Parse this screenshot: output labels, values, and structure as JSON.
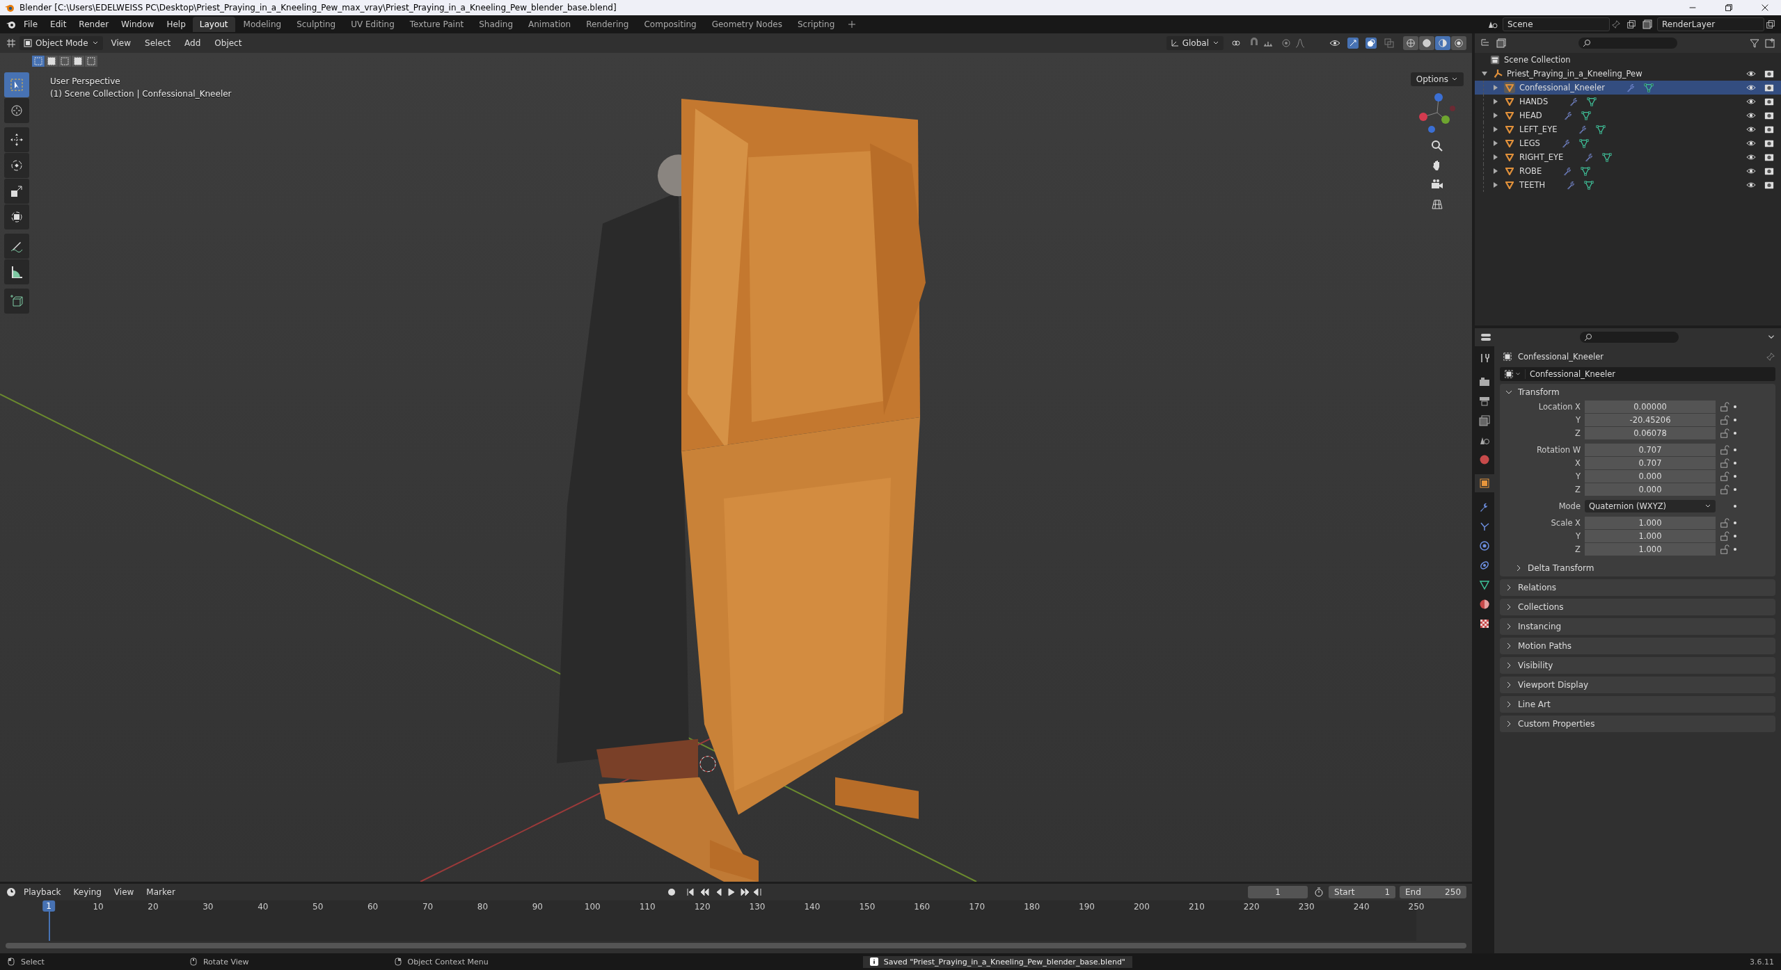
{
  "window": {
    "title": "Blender [C:\\Users\\EDELWEISS PC\\Desktop\\Priest_Praying_in_a_Kneeling_Pew_max_vray\\Priest_Praying_in_a_Kneeling_Pew_blender_base.blend]"
  },
  "menu": [
    "File",
    "Edit",
    "Render",
    "Window",
    "Help"
  ],
  "workspaces": [
    {
      "label": "Layout",
      "selected": true
    },
    {
      "label": "Modeling",
      "selected": false
    },
    {
      "label": "Sculpting",
      "selected": false
    },
    {
      "label": "UV Editing",
      "selected": false
    },
    {
      "label": "Texture Paint",
      "selected": false
    },
    {
      "label": "Shading",
      "selected": false
    },
    {
      "label": "Animation",
      "selected": false
    },
    {
      "label": "Rendering",
      "selected": false
    },
    {
      "label": "Compositing",
      "selected": false
    },
    {
      "label": "Geometry Nodes",
      "selected": false
    },
    {
      "label": "Scripting",
      "selected": false
    }
  ],
  "scene": "Scene",
  "view_layer": "RenderLayer",
  "viewport": {
    "mode": "Object Mode",
    "menus": [
      "View",
      "Select",
      "Add",
      "Object"
    ],
    "orientation": "Global",
    "options": "Options",
    "select_modes": [
      {
        "selected": true
      },
      {
        "selected": false
      },
      {
        "selected": false
      },
      {
        "selected": false
      },
      {
        "selected": false
      }
    ],
    "shading": [
      {
        "selected": false
      },
      {
        "selected": false
      },
      {
        "selected": true
      },
      {
        "selected": false
      }
    ],
    "overlay_lines": [
      "User Perspective",
      "(1) Scene Collection | Confessional_Kneeler"
    ],
    "tool_groups": [
      [
        {
          "kind": "select",
          "selected": true
        },
        {
          "kind": "cursor",
          "selected": false
        }
      ],
      [
        {
          "kind": "move",
          "selected": false
        },
        {
          "kind": "rotate",
          "selected": false
        },
        {
          "kind": "scale",
          "selected": false
        },
        {
          "kind": "transform",
          "selected": false
        }
      ],
      [
        {
          "kind": "annotate",
          "selected": false
        },
        {
          "kind": "measure",
          "selected": false
        }
      ],
      [
        {
          "kind": "add-cube",
          "selected": false
        }
      ]
    ]
  },
  "outliner": {
    "scene_collection": "Scene Collection",
    "items": [
      {
        "name": "Priest_Praying_in_a_Kneeling_Pew",
        "kind": "empty",
        "expanded": true,
        "selected": false,
        "children": [
          {
            "name": "Confessional_Kneeler",
            "kind": "mesh",
            "expanded": false,
            "selected": true
          },
          {
            "name": "HANDS",
            "kind": "mesh",
            "expanded": false,
            "selected": false
          },
          {
            "name": "HEAD",
            "kind": "mesh",
            "expanded": false,
            "selected": false
          },
          {
            "name": "LEFT_EYE",
            "kind": "mesh",
            "expanded": false,
            "selected": false
          },
          {
            "name": "LEGS",
            "kind": "mesh",
            "expanded": false,
            "selected": false
          },
          {
            "name": "RIGHT_EYE",
            "kind": "mesh",
            "expanded": false,
            "selected": false
          },
          {
            "name": "ROBE",
            "kind": "mesh",
            "expanded": false,
            "selected": false
          },
          {
            "name": "TEETH",
            "kind": "mesh",
            "expanded": false,
            "selected": false
          }
        ]
      }
    ]
  },
  "properties": {
    "tabs": [
      {
        "kind": "tool",
        "selected": false
      },
      {
        "kind": "render",
        "selected": false
      },
      {
        "kind": "output",
        "selected": false
      },
      {
        "kind": "view-layer",
        "selected": false
      },
      {
        "kind": "scene",
        "selected": false
      },
      {
        "kind": "world",
        "selected": false
      },
      {
        "kind": "object",
        "selected": true
      },
      {
        "kind": "modifiers",
        "selected": false
      },
      {
        "kind": "particles",
        "selected": false
      },
      {
        "kind": "physics",
        "selected": false
      },
      {
        "kind": "constraints",
        "selected": false
      },
      {
        "kind": "data",
        "selected": false
      },
      {
        "kind": "material",
        "selected": false
      },
      {
        "kind": "texture",
        "selected": false
      }
    ],
    "object": "Confessional_Kneeler",
    "object_field": "Confessional_Kneeler",
    "transform": {
      "title": "Transform",
      "expanded": true,
      "groups": [
        [
          {
            "label": "Location X",
            "value": "0.00000",
            "kind": "number"
          },
          {
            "label": "Y",
            "value": "-20.45206",
            "kind": "number"
          },
          {
            "label": "Z",
            "value": "0.06078",
            "kind": "number"
          }
        ],
        [
          {
            "label": "Rotation W",
            "value": "0.707",
            "kind": "number"
          },
          {
            "label": "X",
            "value": "0.707",
            "kind": "number"
          },
          {
            "label": "Y",
            "value": "0.000",
            "kind": "number"
          },
          {
            "label": "Z",
            "value": "0.000",
            "kind": "number"
          }
        ],
        [
          {
            "label": "Mode",
            "value": "Quaternion (WXYZ)",
            "kind": "dropdown"
          }
        ],
        [
          {
            "label": "Scale X",
            "value": "1.000",
            "kind": "number"
          },
          {
            "label": "Y",
            "value": "1.000",
            "kind": "number"
          },
          {
            "label": "Z",
            "value": "1.000",
            "kind": "number"
          }
        ]
      ],
      "subpanel": {
        "title": "Delta Transform",
        "expanded": false
      }
    },
    "panels": [
      {
        "title": "Relations",
        "expanded": false
      },
      {
        "title": "Collections",
        "expanded": false
      },
      {
        "title": "Instancing",
        "expanded": false
      },
      {
        "title": "Motion Paths",
        "expanded": false
      },
      {
        "title": "Visibility",
        "expanded": false
      },
      {
        "title": "Viewport Display",
        "expanded": false
      },
      {
        "title": "Line Art",
        "expanded": false
      },
      {
        "title": "Custom Properties",
        "expanded": false
      }
    ]
  },
  "timeline": {
    "menus": [
      "Playback",
      "Keying",
      "View",
      "Marker"
    ],
    "current_frame": "1",
    "start_label": "Start",
    "start": "1",
    "end_label": "End",
    "end": "250",
    "playhead": "1",
    "ruler": [
      "10",
      "20",
      "30",
      "40",
      "50",
      "60",
      "70",
      "80",
      "90",
      "100",
      "110",
      "120",
      "130",
      "140",
      "150",
      "160",
      "170",
      "180",
      "190",
      "200",
      "210",
      "220",
      "230",
      "240",
      "250"
    ]
  },
  "status_bar": {
    "hints": [
      "Select",
      "Rotate View",
      "Object Context Menu"
    ],
    "message": "Saved \"Priest_Praying_in_a_Kneeling_Pew_blender_base.blend\"",
    "version": "3.6.11"
  }
}
